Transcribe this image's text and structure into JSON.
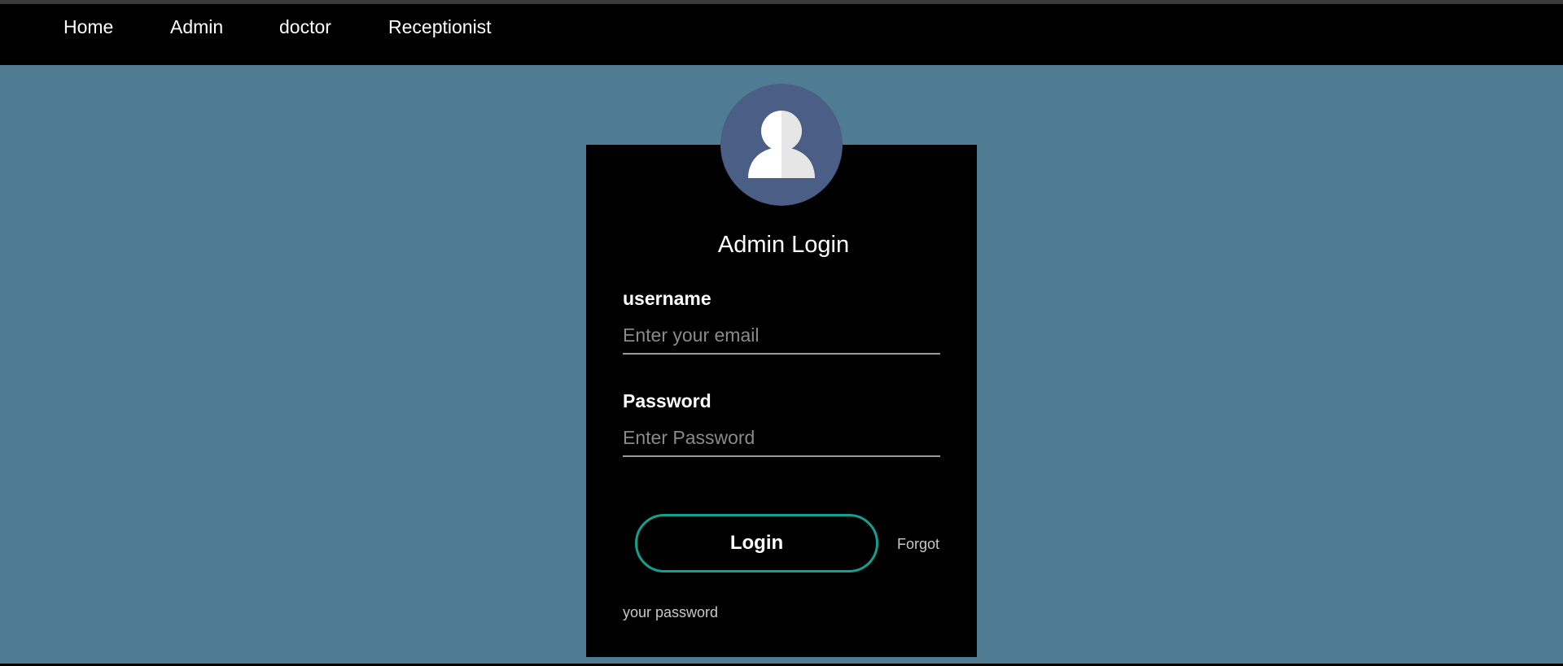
{
  "nav": {
    "items": [
      {
        "label": "Home"
      },
      {
        "label": "Admin"
      },
      {
        "label": "doctor"
      },
      {
        "label": "Receptionist"
      }
    ]
  },
  "login": {
    "title": "Admin Login",
    "username": {
      "label": "username",
      "placeholder": "Enter your email"
    },
    "password": {
      "label": "Password",
      "placeholder": "Enter Password"
    },
    "login_button": "Login",
    "forgot_part1": "Forgot",
    "forgot_part2": "your password"
  },
  "colors": {
    "page_background": "#4f7c93",
    "navbar": "#000000",
    "card": "#000000",
    "avatar_circle": "#4a5e86",
    "button_border": "#14a08e"
  },
  "icons": {
    "avatar": "user-silhouette-icon"
  }
}
